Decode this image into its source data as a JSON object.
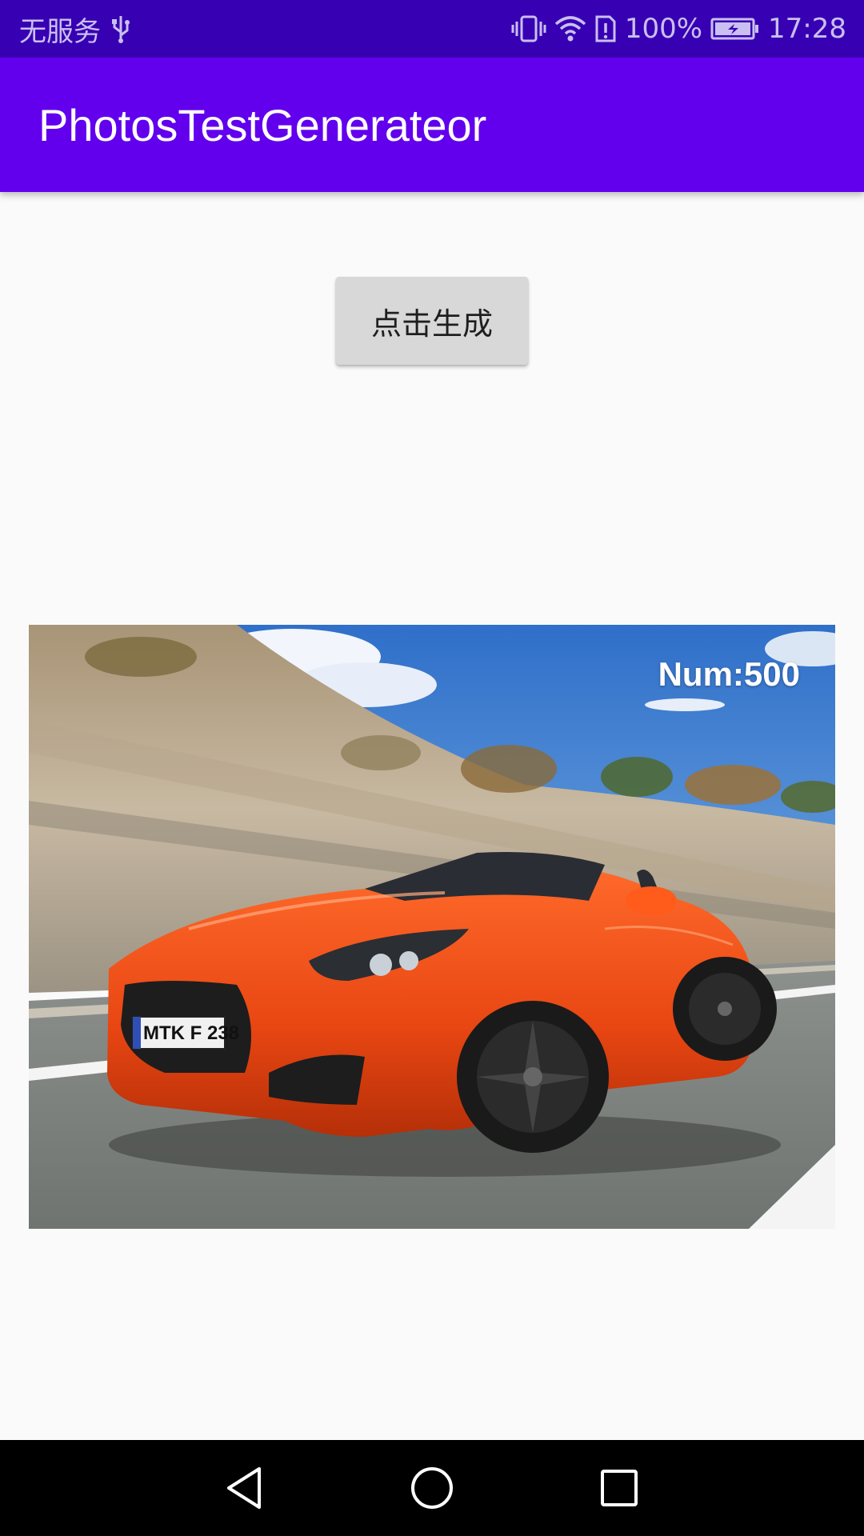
{
  "status_bar": {
    "carrier": "无服务",
    "battery_percent": "100%",
    "time": "17:28",
    "icons": [
      "usb-icon",
      "vibrate-icon",
      "wifi-icon",
      "sim-alert-icon",
      "battery-charging-icon"
    ]
  },
  "app_bar": {
    "title": "PhotosTestGenerateor",
    "color": "#6200ee"
  },
  "main": {
    "generate_button_label": "点击生成",
    "photo": {
      "subject": "orange-convertible-car",
      "overlay_text": "Num:500",
      "plate_text": "MTK F 238"
    }
  },
  "nav_bar": {
    "icons": [
      "back-icon",
      "home-icon",
      "recents-icon"
    ]
  }
}
